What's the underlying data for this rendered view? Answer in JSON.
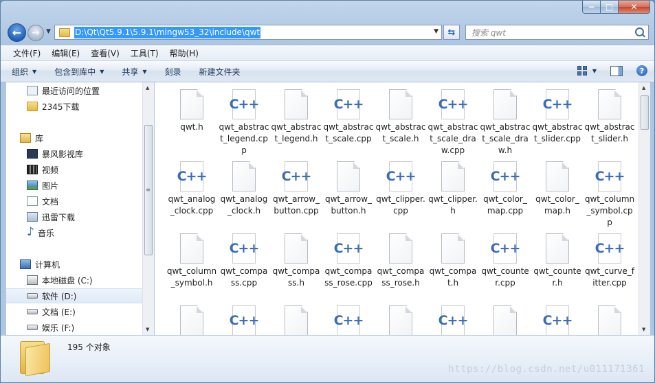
{
  "window": {
    "caption_buttons": {
      "minimize": "−",
      "maximize": "□",
      "close": "✕"
    }
  },
  "address_bar": {
    "path": "D:\\Qt\\Qt5.9.1\\5.9.1\\mingw53_32\\include\\qwt"
  },
  "search": {
    "placeholder": "搜索 qwt"
  },
  "menu": [
    "文件(F)",
    "编辑(E)",
    "查看(V)",
    "工具(T)",
    "帮助(H)"
  ],
  "commands": [
    {
      "label": "组织",
      "dropdown": true
    },
    {
      "label": "包含到库中",
      "dropdown": true
    },
    {
      "label": "共享",
      "dropdown": true
    },
    {
      "label": "刻录",
      "dropdown": false
    },
    {
      "label": "新建文件夹",
      "dropdown": false
    }
  ],
  "nav": {
    "favorites": [
      {
        "label": "最近访问的位置",
        "icon": "recent-places-icon"
      },
      {
        "label": "2345下载",
        "icon": "folder-icon"
      }
    ],
    "libraries_label": "库",
    "libraries": [
      {
        "label": "暴风影视库",
        "icon": "video-library-icon"
      },
      {
        "label": "视频",
        "icon": "video-icon"
      },
      {
        "label": "图片",
        "icon": "pictures-icon"
      },
      {
        "label": "文档",
        "icon": "documents-icon"
      },
      {
        "label": "迅雷下载",
        "icon": "download-icon"
      },
      {
        "label": "音乐",
        "icon": "music-icon"
      }
    ],
    "computer_label": "计算机",
    "drives": [
      {
        "label": "本地磁盘 (C:)",
        "icon": "system-drive-icon",
        "selected": false
      },
      {
        "label": "软件 (D:)",
        "icon": "drive-icon",
        "selected": true
      },
      {
        "label": "文档 (E:)",
        "icon": "drive-icon",
        "selected": false
      },
      {
        "label": "娱乐 (F:)",
        "icon": "drive-icon",
        "selected": false
      }
    ]
  },
  "files": [
    {
      "name": "qwt.h",
      "type": "h"
    },
    {
      "name": "qwt_abstract_legend.cpp",
      "type": "cpp"
    },
    {
      "name": "qwt_abstract_legend.h",
      "type": "h"
    },
    {
      "name": "qwt_abstract_scale.cpp",
      "type": "cpp"
    },
    {
      "name": "qwt_abstract_scale.h",
      "type": "h"
    },
    {
      "name": "qwt_abstract_scale_draw.cpp",
      "type": "cpp"
    },
    {
      "name": "qwt_abstract_scale_draw.h",
      "type": "h"
    },
    {
      "name": "qwt_abstract_slider.cpp",
      "type": "cpp"
    },
    {
      "name": "qwt_abstract_slider.h",
      "type": "h"
    },
    {
      "name": "qwt_analog_clock.cpp",
      "type": "cpp"
    },
    {
      "name": "qwt_analog_clock.h",
      "type": "h"
    },
    {
      "name": "qwt_arrow_button.cpp",
      "type": "cpp"
    },
    {
      "name": "qwt_arrow_button.h",
      "type": "h"
    },
    {
      "name": "qwt_clipper.cpp",
      "type": "cpp"
    },
    {
      "name": "qwt_clipper.h",
      "type": "h"
    },
    {
      "name": "qwt_color_map.cpp",
      "type": "cpp"
    },
    {
      "name": "qwt_color_map.h",
      "type": "h"
    },
    {
      "name": "qwt_column_symbol.cpp",
      "type": "cpp"
    },
    {
      "name": "qwt_column_symbol.h",
      "type": "h"
    },
    {
      "name": "qwt_compass.cpp",
      "type": "cpp"
    },
    {
      "name": "qwt_compass.h",
      "type": "h"
    },
    {
      "name": "qwt_compass_rose.cpp",
      "type": "cpp"
    },
    {
      "name": "qwt_compass_rose.h",
      "type": "h"
    },
    {
      "name": "qwt_compat.h",
      "type": "h"
    },
    {
      "name": "qwt_counter.cpp",
      "type": "cpp"
    },
    {
      "name": "qwt_counter.h",
      "type": "h"
    },
    {
      "name": "qwt_curve_fitter.cpp",
      "type": "cpp"
    },
    {
      "name": "",
      "type": "h"
    },
    {
      "name": "",
      "type": "cpp"
    },
    {
      "name": "",
      "type": "h"
    },
    {
      "name": "",
      "type": "cpp"
    },
    {
      "name": "",
      "type": "h"
    },
    {
      "name": "",
      "type": "cpp"
    },
    {
      "name": "",
      "type": "h"
    },
    {
      "name": "",
      "type": "cpp"
    },
    {
      "name": "",
      "type": "h"
    }
  ],
  "cpp_icon_text": "C++",
  "status": {
    "count_text": "195 个对象"
  },
  "watermark": "https://blog.csdn.net/u011171361",
  "colors": {
    "selection": "#3399ff",
    "cpp_icon": "#3b6db8"
  }
}
